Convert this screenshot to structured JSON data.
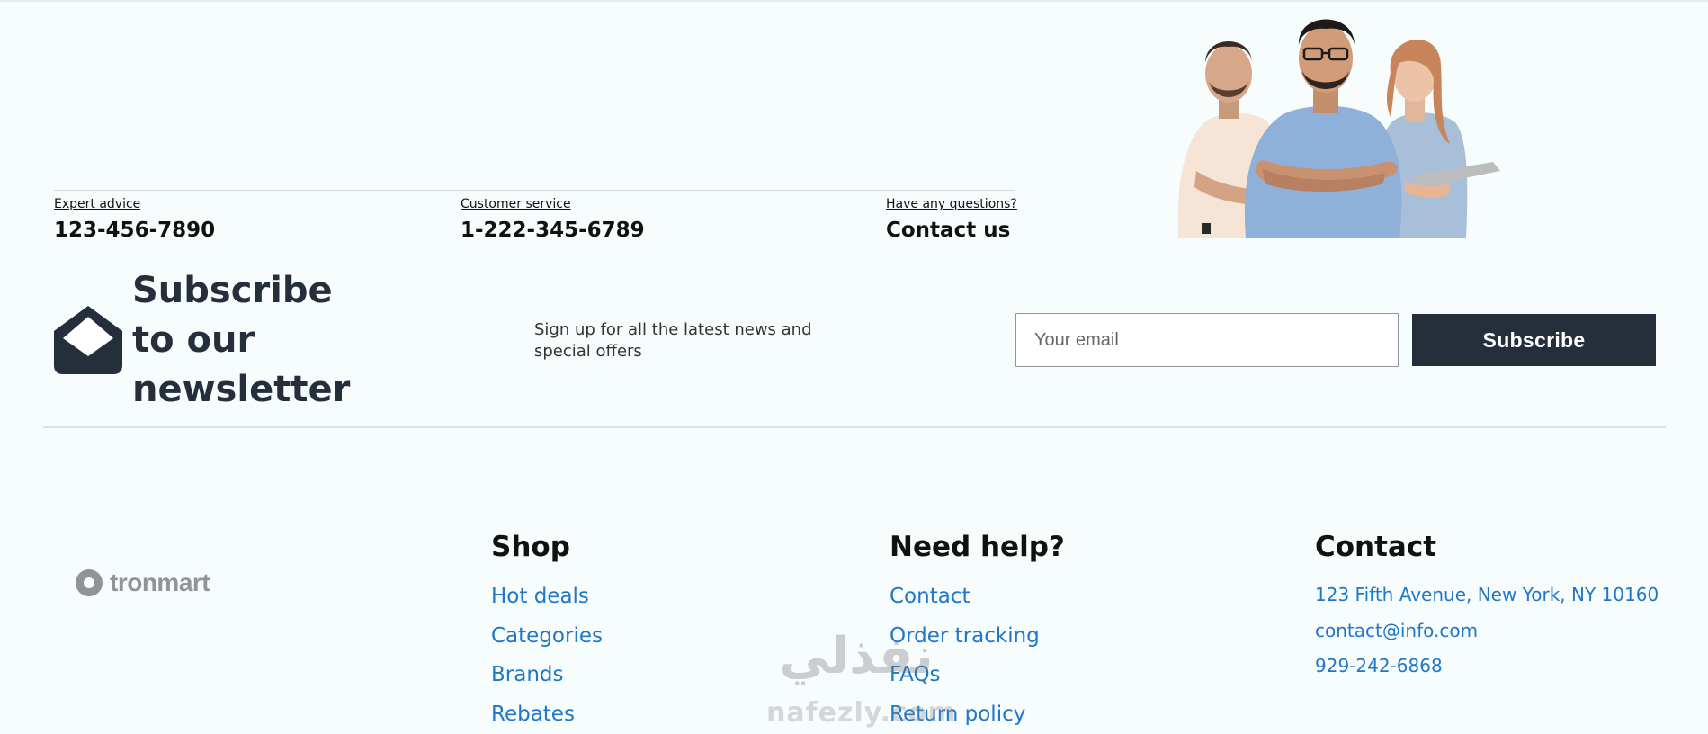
{
  "contact_strip": {
    "items": [
      {
        "label": "Expert advice",
        "value": "123-456-7890"
      },
      {
        "label": "Customer service",
        "value": "1-222-345-6789"
      },
      {
        "label": "Have any questions?",
        "value": "Contact us"
      }
    ]
  },
  "newsletter": {
    "title": "Subscribe to our newsletter",
    "description": "Sign up for all the latest news and special offers",
    "email_placeholder": "Your email",
    "button_label": "Subscribe",
    "icon": "envelope-open-icon"
  },
  "footer": {
    "logo_text": "tronmart",
    "columns": [
      {
        "heading": "Shop",
        "links": [
          "Hot deals",
          "Categories",
          "Brands",
          "Rebates"
        ]
      },
      {
        "heading": "Need help?",
        "links": [
          "Contact",
          "Order tracking",
          "FAQs",
          "Return policy"
        ]
      }
    ],
    "contact": {
      "heading": "Contact",
      "address": "123 Fifth Avenue, New York, NY 10160",
      "email": "contact@info.com",
      "phone": "929-242-6868"
    }
  },
  "watermark": {
    "script": "نفذلي",
    "latin": "nafezly.com"
  },
  "colors": {
    "background": "#f7fcfd",
    "dark_navy": "#252f3c",
    "link_blue": "#1f77c8",
    "logo_gray": "#909497"
  }
}
